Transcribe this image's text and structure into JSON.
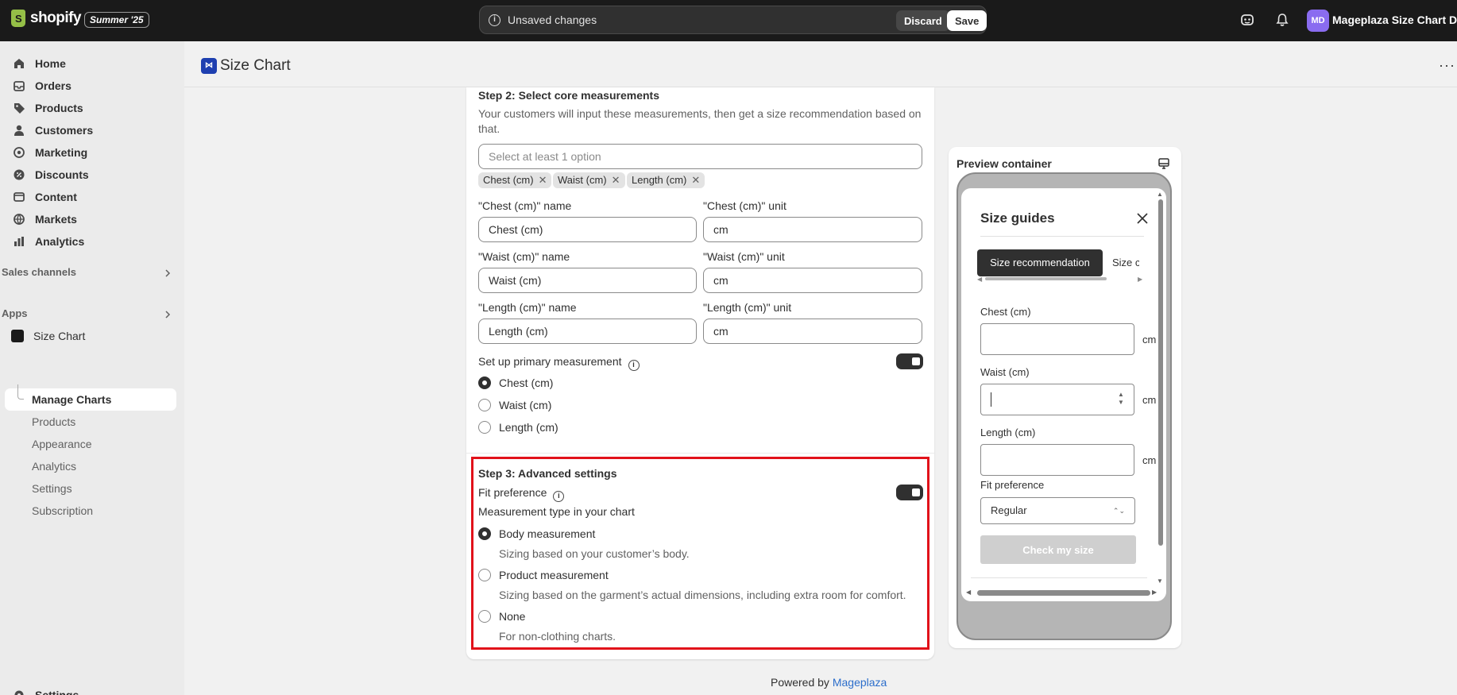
{
  "topbar": {
    "logo_text": "shopify",
    "season_badge": "Summer '25",
    "unsaved_message": "Unsaved changes",
    "discard_label": "Discard",
    "save_label": "Save",
    "store_initials": "MD",
    "store_name": "Mageplaza Size Chart De..."
  },
  "sidebar": {
    "main_items": [
      {
        "label": "Home",
        "icon": "home-icon"
      },
      {
        "label": "Orders",
        "icon": "orders-icon"
      },
      {
        "label": "Products",
        "icon": "products-tag-icon"
      },
      {
        "label": "Customers",
        "icon": "person-icon"
      },
      {
        "label": "Marketing",
        "icon": "target-icon"
      },
      {
        "label": "Discounts",
        "icon": "discount-icon"
      },
      {
        "label": "Content",
        "icon": "content-icon"
      },
      {
        "label": "Markets",
        "icon": "globe-icon"
      },
      {
        "label": "Analytics",
        "icon": "bar-chart-icon"
      }
    ],
    "sales_channels_label": "Sales channels",
    "apps_label": "Apps",
    "app_name": "Size Chart",
    "app_sub_items": [
      "Manage Charts",
      "Products",
      "Appearance",
      "Analytics",
      "Settings",
      "Subscription"
    ],
    "settings_label": "Settings"
  },
  "page": {
    "title": "Size Chart",
    "more_label": "···"
  },
  "step2": {
    "heading": "Step 2: Select core measurements",
    "description": "Your customers will input these measurements, then get a size recommendation based on that.",
    "select_placeholder": "Select at least 1 option",
    "tags": [
      "Chest (cm)",
      "Waist (cm)",
      "Length (cm)"
    ],
    "fields": [
      {
        "name_label": "\"Chest (cm)\" name",
        "name_value": "Chest (cm)",
        "unit_label": "\"Chest (cm)\" unit",
        "unit_value": "cm"
      },
      {
        "name_label": "\"Waist (cm)\" name",
        "name_value": "Waist (cm)",
        "unit_label": "\"Waist (cm)\" unit",
        "unit_value": "cm"
      },
      {
        "name_label": "\"Length (cm)\" name",
        "name_value": "Length (cm)",
        "unit_label": "\"Length (cm)\" unit",
        "unit_value": "cm"
      }
    ],
    "primary_label": "Set up primary measurement",
    "primary_options": [
      "Chest (cm)",
      "Waist (cm)",
      "Length (cm)"
    ],
    "primary_selected": "Chest (cm)"
  },
  "step3": {
    "heading": "Step 3: Advanced settings",
    "fit_label": "Fit preference",
    "type_label": "Measurement type in your chart",
    "options": [
      {
        "label": "Body measurement",
        "help": "Sizing based on your customer’s body."
      },
      {
        "label": "Product measurement",
        "help": "Sizing based on the garment’s actual dimensions, including extra room for comfort."
      },
      {
        "label": "None",
        "help": "For non-clothing charts."
      }
    ],
    "selected": "Body measurement"
  },
  "preview": {
    "title": "Preview container",
    "modal_title": "Size guides",
    "tab_active": "Size recommendation",
    "tab_inactive": "Size chart",
    "fields": [
      {
        "label": "Chest (cm)",
        "unit": "cm"
      },
      {
        "label": "Waist (cm)",
        "unit": "cm"
      },
      {
        "label": "Length (cm)",
        "unit": "cm"
      }
    ],
    "fit_label": "Fit preference",
    "fit_value": "Regular",
    "check_label": "Check my size"
  },
  "footer": {
    "powered_prefix": "Powered by",
    "powered_link": "Mageplaza"
  },
  "colors": {
    "topbar": "#1a1a1a",
    "highlight_border": "#e1121a",
    "link": "#2c6ecb"
  }
}
